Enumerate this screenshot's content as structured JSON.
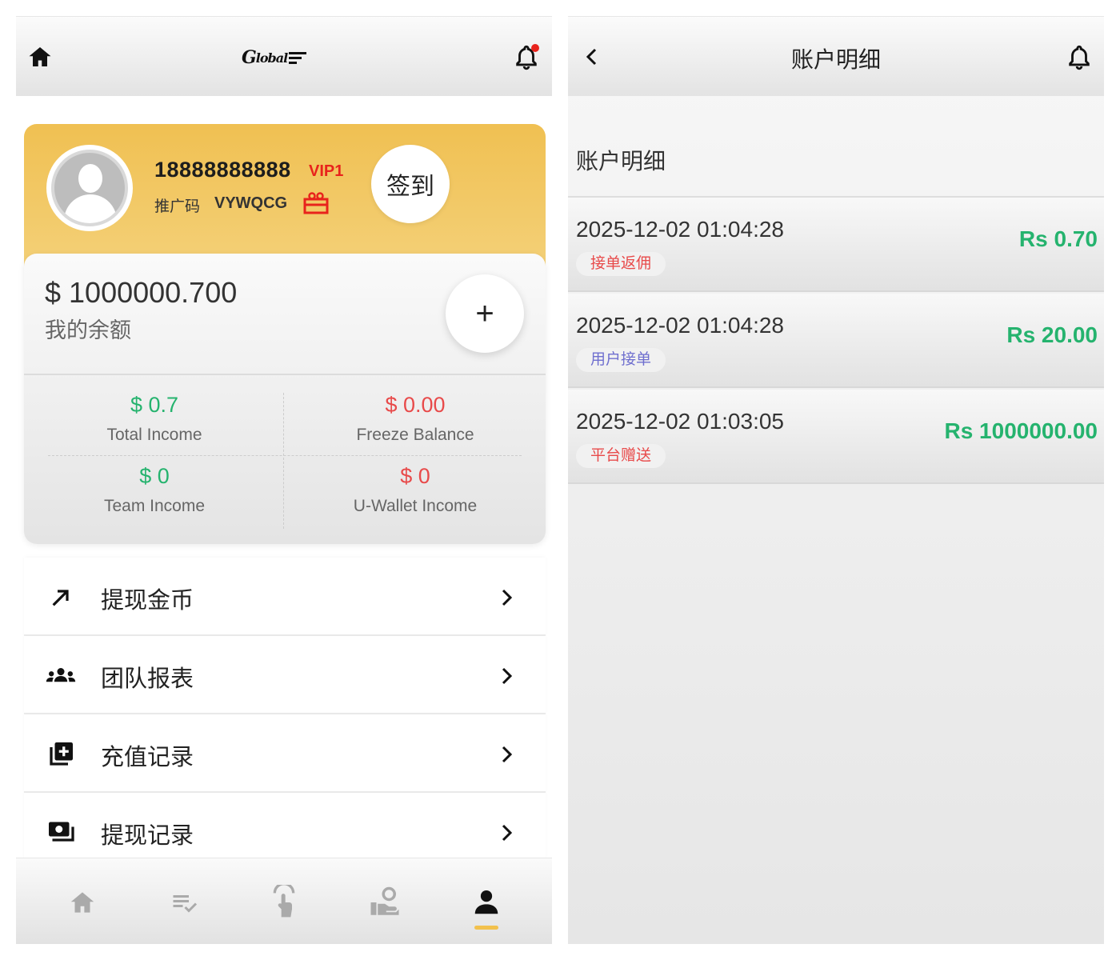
{
  "left": {
    "profile": {
      "phone": "18888888888",
      "vip": "VIP1",
      "referral_label": "推广码",
      "referral_code": "VYWQCG",
      "signin_label": "签到"
    },
    "balance": {
      "amount": "$ 1000000.700",
      "label": "我的余额",
      "add_label": "+"
    },
    "stats": [
      {
        "value": "$ 0.7",
        "label": "Total Income",
        "color": "#25b36e"
      },
      {
        "value": "$ 0.00",
        "label": "Freeze Balance",
        "color": "#e84a4a"
      },
      {
        "value": "$ 0",
        "label": "Team Income",
        "color": "#25b36e"
      },
      {
        "value": "$ 0",
        "label": "U-Wallet Income",
        "color": "#e84a4a"
      }
    ],
    "menu": [
      {
        "label": "提现金币",
        "icon": "arrow-up-right-icon"
      },
      {
        "label": "团队报表",
        "icon": "team-icon"
      },
      {
        "label": "充值记录",
        "icon": "add-box-icon"
      },
      {
        "label": "提现记录",
        "icon": "money-icon"
      }
    ],
    "tabs": [
      "home-icon",
      "tasks-icon",
      "tap-icon",
      "hand-coin-icon",
      "person-icon"
    ],
    "active_tab": 4,
    "accent_color": "#f2c14d"
  },
  "right": {
    "title": "账户明细",
    "section_title": "账户明细",
    "transactions": [
      {
        "time": "2025-12-02 01:04:28",
        "tag": "接单返佣",
        "tag_color": "#e84a4a",
        "amount": "Rs 0.70"
      },
      {
        "time": "2025-12-02 01:04:28",
        "tag": "用户接单",
        "tag_color": "#6f6fcf",
        "amount": "Rs 20.00"
      },
      {
        "time": "2025-12-02 01:03:05",
        "tag": "平台赠送",
        "tag_color": "#e84a4a",
        "amount": "Rs 1000000.00"
      }
    ]
  }
}
